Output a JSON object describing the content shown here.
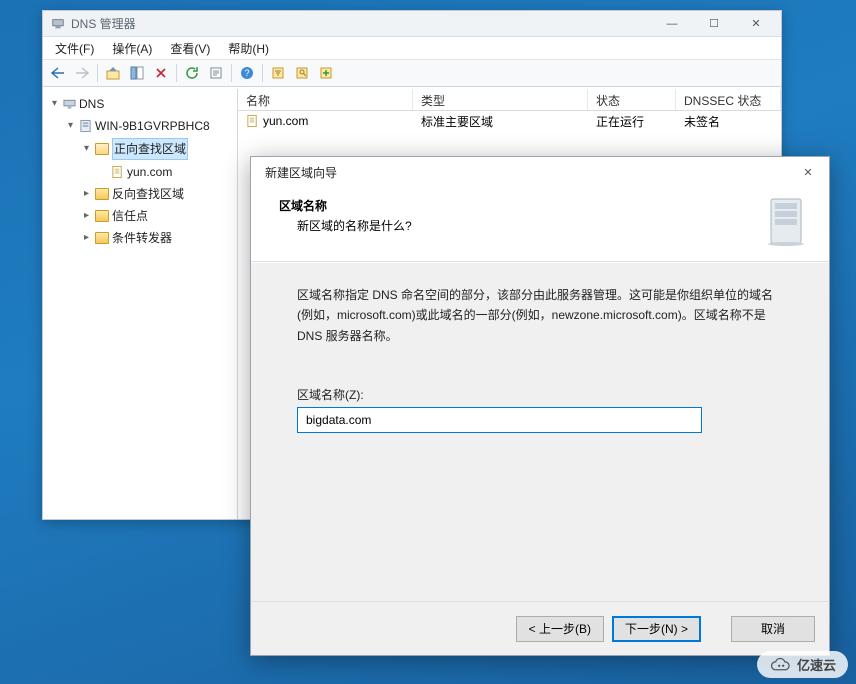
{
  "window": {
    "title": "DNS 管理器",
    "menu": {
      "file": "文件(F)",
      "action": "操作(A)",
      "view": "查看(V)",
      "help": "帮助(H)"
    },
    "controls": {
      "min": "—",
      "max": "☐",
      "close": "✕"
    }
  },
  "tree": {
    "root": "DNS",
    "server": "WIN-9B1GVRPBHC8",
    "forward": "正向查找区域",
    "forward_zone": "yun.com",
    "reverse": "反向查找区域",
    "trust": "信任点",
    "conditional": "条件转发器"
  },
  "list": {
    "headers": {
      "name": "名称",
      "type": "类型",
      "status": "状态",
      "dnssec": "DNSSEC 状态"
    },
    "rows": [
      {
        "name": "yun.com",
        "type": "标准主要区域",
        "status": "正在运行",
        "dnssec": "未签名"
      }
    ]
  },
  "wizard": {
    "title": "新建区域向导",
    "heading": "区域名称",
    "subheading": "新区域的名称是什么?",
    "description": "区域名称指定 DNS 命名空间的部分，该部分由此服务器管理。这可能是你组织单位的域名(例如，microsoft.com)或此域名的一部分(例如，newzone.microsoft.com)。区域名称不是 DNS 服务器名称。",
    "field_label": "区域名称(Z):",
    "field_value": "bigdata.com",
    "btn_back": "< 上一步(B)",
    "btn_next": "下一步(N) >",
    "btn_cancel": "取消",
    "close": "✕"
  },
  "watermark": "亿速云"
}
